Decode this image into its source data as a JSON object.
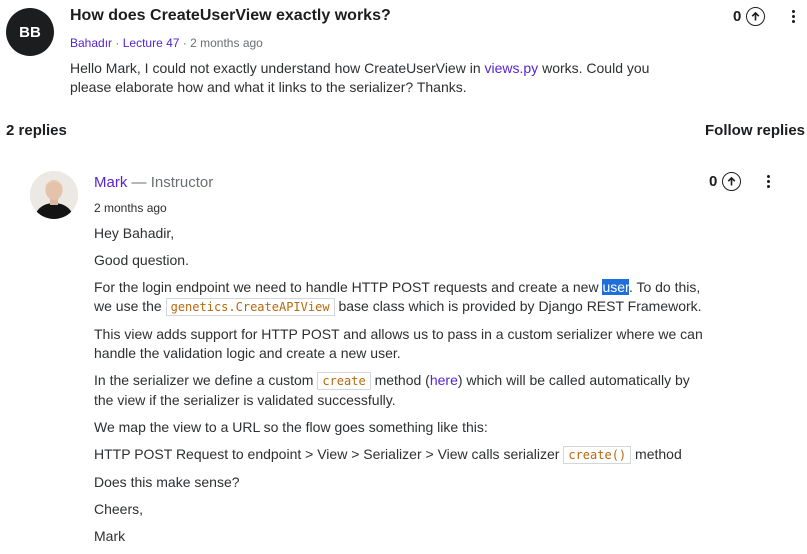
{
  "question": {
    "avatar_initials": "BB",
    "title": "How does CreateUserView exactly works?",
    "author": "Bahadır",
    "lecture": "Lecture 47",
    "time": "2 months ago",
    "body_pre": "Hello Mark, I could not exactly understand how CreateUserView in ",
    "body_link": "views.py",
    "body_post": " works. Could you please elaborate how and what it links to the serializer? Thanks.",
    "votes": "0"
  },
  "replies_header": {
    "count_label": "2 replies",
    "follow_label": "Follow replies"
  },
  "reply": {
    "author": "Mark",
    "role": "Instructor",
    "date": "2 months ago",
    "votes": "0",
    "greeting": "Hey Bahadir,",
    "p1": "Good question.",
    "p2_a": "For the login endpoint we need to handle HTTP POST requests and create a new ",
    "p2_highlight": "user",
    "p2_b": ". To do this, we use the ",
    "p2_code": "genetics.CreateAPIView",
    "p2_c": " base class which is provided by Django REST Framework.",
    "p3": "This view adds support for HTTP POST and allows us to pass in a custom serializer where we can handle the validation logic and create a new user.",
    "p4_a": "In the serializer we define a custom ",
    "p4_code": "create",
    "p4_b": " method (",
    "p4_link": "here",
    "p4_c": ") which will be called automatically by the view if the serializer is validated successfully.",
    "p5": "We map the view to a URL so the flow goes something like this:",
    "p6_a": "HTTP POST Request to endpoint > View > Serializer > View calls serializer ",
    "p6_code": "create()",
    "p6_b": " method",
    "p7": "Does this make sense?",
    "p8": "Cheers,",
    "p9": "Mark"
  },
  "colors": {
    "link": "#5624d0",
    "code": "#b4690e",
    "text": "#2d2f31",
    "selection": "#1e6fd9"
  },
  "icons": [
    "arrow-up-circle-icon",
    "more-vertical-icon"
  ]
}
